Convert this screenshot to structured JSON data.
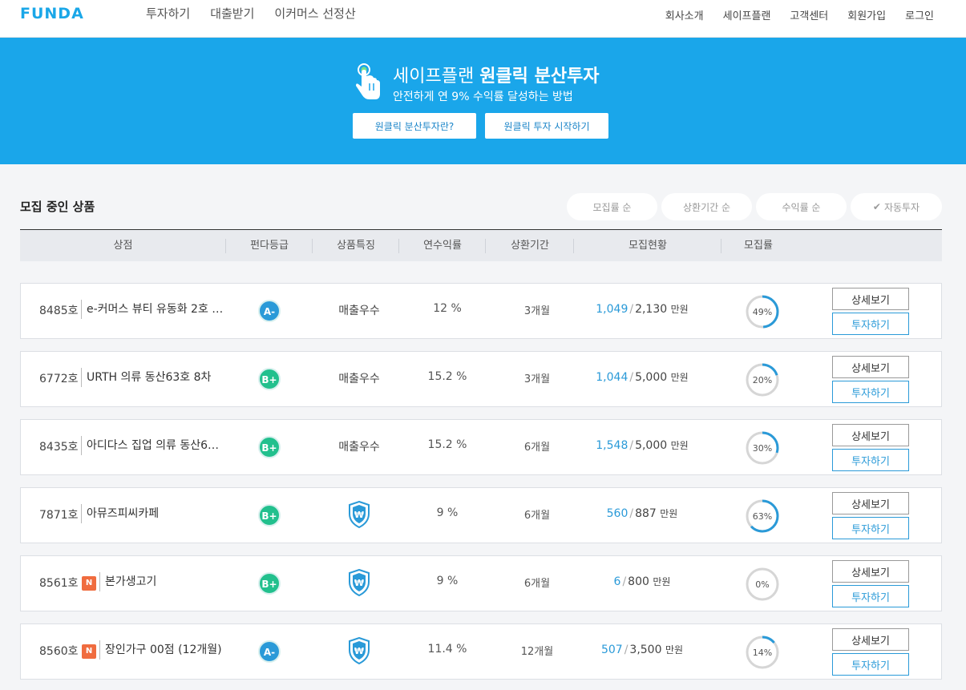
{
  "header": {
    "logo": "FUNDA",
    "nav": [
      "투자하기",
      "대출받기",
      "이커머스 선정산"
    ],
    "subnav": [
      "회사소개",
      "세이프플랜",
      "고객센터",
      "회원가입",
      "로그인"
    ]
  },
  "banner": {
    "title_normal": "세이프플랜 ",
    "title_bold": "원클릭 분산투자",
    "subtitle": "안전하게 연 9% 수익률 달성하는 방법",
    "btn_about": "원클릭 분산투자란?",
    "btn_start": "원클릭 투자 시작하기",
    "icon": "hand-pointer-icon"
  },
  "section": {
    "title": "모집 중인 상품",
    "sorts": [
      "모집률 순",
      "상환기간 순",
      "수익률 순"
    ],
    "auto_invest": "자동투자"
  },
  "table": {
    "headers": [
      "상점",
      "펀다등급",
      "상품특징",
      "연수익률",
      "상환기간",
      "모집현황",
      "모집률"
    ],
    "detail_label": "상세보기",
    "invest_label": "투자하기",
    "unit": "만원",
    "rows": [
      {
        "no": "8485호",
        "new": false,
        "name": "e-커머스 뷰티 유동화 2호 …",
        "grade": "A-",
        "feature_text": "매출우수",
        "feature_icon": "",
        "rate": "12 %",
        "term": "3개월",
        "current": "1,049",
        "total": "2,130",
        "percent": 49,
        "percent_label": "49%"
      },
      {
        "no": "6772호",
        "new": false,
        "name": "URTH 의류 동산63호 8차",
        "grade": "B+",
        "feature_text": "매출우수",
        "feature_icon": "",
        "rate": "15.2 %",
        "term": "3개월",
        "current": "1,044",
        "total": "5,000",
        "percent": 20,
        "percent_label": "20%"
      },
      {
        "no": "8435호",
        "new": false,
        "name": "아디다스 집업 의류 동산6…",
        "grade": "B+",
        "feature_text": "매출우수",
        "feature_icon": "",
        "rate": "15.2 %",
        "term": "6개월",
        "current": "1,548",
        "total": "5,000",
        "percent": 30,
        "percent_label": "30%"
      },
      {
        "no": "7871호",
        "new": false,
        "name": "아뮤즈피씨카페",
        "grade": "B+",
        "feature_text": "",
        "feature_icon": "won-shield-icon",
        "rate": "9 %",
        "term": "6개월",
        "current": "560",
        "total": "887",
        "percent": 63,
        "percent_label": "63%"
      },
      {
        "no": "8561호",
        "new": true,
        "new_label": "N",
        "name": "본가생고기",
        "grade": "B+",
        "feature_text": "",
        "feature_icon": "won-shield-icon",
        "rate": "9 %",
        "term": "6개월",
        "current": "6",
        "total": "800",
        "percent": 0,
        "percent_label": "0%"
      },
      {
        "no": "8560호",
        "new": true,
        "new_label": "N",
        "name": "장인가구 00점 (12개월)",
        "grade": "A-",
        "feature_text": "",
        "feature_icon": "won-shield-icon",
        "rate": "11.4 %",
        "term": "12개월",
        "current": "507",
        "total": "3,500",
        "percent": 14,
        "percent_label": "14%"
      }
    ]
  },
  "colors": {
    "brand": "#1aa6ea",
    "accent": "#2a9ad8",
    "grade_a": "#2a9ad8",
    "grade_b": "#22c08d",
    "new_badge": "#f06c3f"
  }
}
